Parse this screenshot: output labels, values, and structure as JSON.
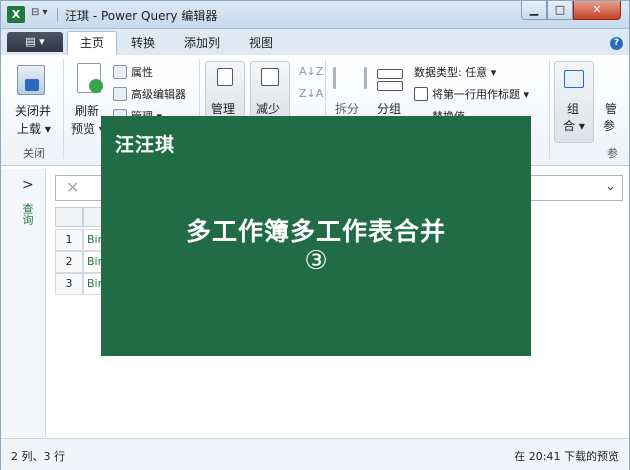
{
  "window": {
    "app_icon_text": "X",
    "qat_glyph": "⊟ ▾",
    "title": "汪琪 - Power Query 编辑器",
    "min_glyph": "▁",
    "max_glyph": "□",
    "close_glyph": "✕"
  },
  "tabs": {
    "file_glyph": "▤ ▾",
    "items": [
      "主页",
      "转换",
      "添加列",
      "视图"
    ],
    "help_glyph": "?"
  },
  "ribbon": {
    "close_load_line1": "关闭并",
    "close_load_line2": "上载 ▾",
    "refresh_line1": "刷新",
    "refresh_line2": "预览 ▾",
    "properties": "属性",
    "advanced_editor": "高级编辑器",
    "manage_small": "管理 ▾",
    "group_close": "关闭",
    "manage_columns": "管理",
    "reduce_rows": "减少",
    "split": "拆分",
    "group_by": "分组",
    "data_type": "数据类型: 任意 ▾",
    "first_row_header": "将第一行用作标题 ▾",
    "replace_values": "替换值",
    "combine_line1": "组",
    "combine_line2": "合 ▾",
    "manage_params_line1": "管",
    "manage_params_line2": "参",
    "params_group": "参",
    "sort_asc": "A↓Z",
    "sort_desc": "Z↓A"
  },
  "left_pane": {
    "chevron": ">",
    "label": "查询"
  },
  "formula_bar": {
    "cancel_glyph": "✕",
    "expand_glyph": "⌄"
  },
  "grid": {
    "rows": [
      {
        "num": "1",
        "value": "Bin"
      },
      {
        "num": "2",
        "value": "Bin"
      },
      {
        "num": "3",
        "value": "Bin"
      }
    ]
  },
  "status": {
    "left": "2 列、3 行",
    "right": "在 20:41 下载的预览"
  },
  "overlay": {
    "brand": "汪汪琪",
    "title": "多工作簿多工作表合并",
    "number": "③"
  },
  "colors": {
    "overlay_bg": "#216c45",
    "excel_green": "#1f7a3e"
  }
}
